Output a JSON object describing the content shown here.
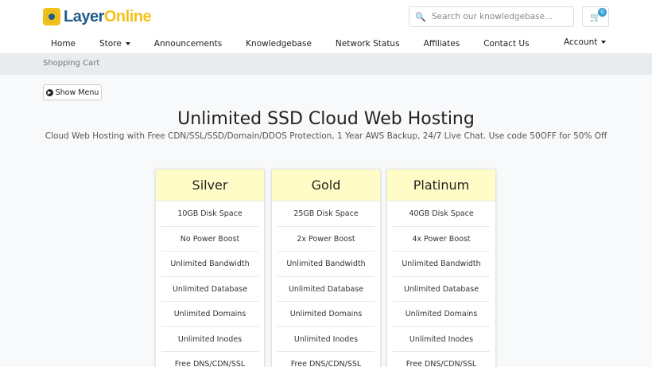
{
  "brand": {
    "part1": "Layer",
    "part2": "Online"
  },
  "search": {
    "placeholder": "Search our knowledgebase..."
  },
  "cart": {
    "icon": "cart-icon",
    "count": "0"
  },
  "nav": {
    "items": [
      "Home",
      "Store",
      "Announcements",
      "Knowledgebase",
      "Network Status",
      "Affiliates",
      "Contact Us"
    ],
    "account": "Account"
  },
  "breadcrumb": "Shopping Cart",
  "show_menu_label": "Show Menu",
  "page": {
    "title": "Unlimited SSD Cloud Web Hosting",
    "subtitle": "Cloud Web Hosting with Free CDN/SSL/SSD/Domain/DDOS Protection, 1 Year AWS Backup, 24/7 Live Chat. Use code 50OFF for 50% Off"
  },
  "colors": {
    "header_accent": "#fffcc7",
    "badge": "#3b9ed6",
    "brand_blue": "#1f5c8b",
    "brand_yellow": "#f2c21b"
  },
  "plans": [
    {
      "name": "Silver",
      "features": [
        "10GB Disk Space",
        "No Power Boost",
        "Unlimited Bandwidth",
        "Unlimited Database",
        "Unlimited Domains",
        "Unlimited Inodes",
        "Free DNS/CDN/SSL"
      ]
    },
    {
      "name": "Gold",
      "features": [
        "25GB Disk Space",
        "2x Power Boost",
        "Unlimited Bandwidth",
        "Unlimited Database",
        "Unlimited Domains",
        "Unlimited Inodes",
        "Free DNS/CDN/SSL"
      ]
    },
    {
      "name": "Platinum",
      "features": [
        "40GB Disk Space",
        "4x Power Boost",
        "Unlimited Bandwidth",
        "Unlimited Database",
        "Unlimited Domains",
        "Unlimited Inodes",
        "Free DNS/CDN/SSL"
      ]
    }
  ]
}
